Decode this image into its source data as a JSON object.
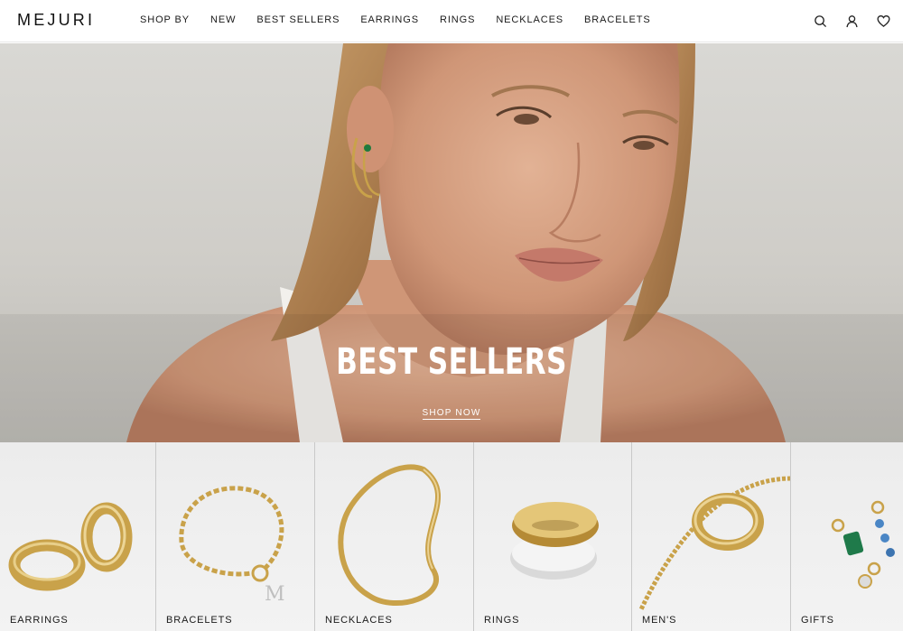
{
  "brand": {
    "logo": "MEJURI"
  },
  "nav": {
    "items": [
      {
        "label": "SHOP BY"
      },
      {
        "label": "NEW"
      },
      {
        "label": "BEST SELLERS"
      },
      {
        "label": "EARRINGS"
      },
      {
        "label": "RINGS"
      },
      {
        "label": "NECKLACES"
      },
      {
        "label": "BRACELETS"
      }
    ]
  },
  "header_icons": [
    "search-icon",
    "account-icon",
    "wishlist-heart-icon"
  ],
  "hero": {
    "title": "BEST SELLERS",
    "cta": "SHOP NOW"
  },
  "categories": [
    {
      "label": "EARRINGS"
    },
    {
      "label": "BRACELETS"
    },
    {
      "label": "NECKLACES"
    },
    {
      "label": "RINGS"
    },
    {
      "label": "MEN'S"
    },
    {
      "label": "GIFTS"
    }
  ],
  "colors": {
    "text": "#1a1a1a",
    "gold": "#c9a24a",
    "hero_overlay_text": "#ffffff"
  }
}
